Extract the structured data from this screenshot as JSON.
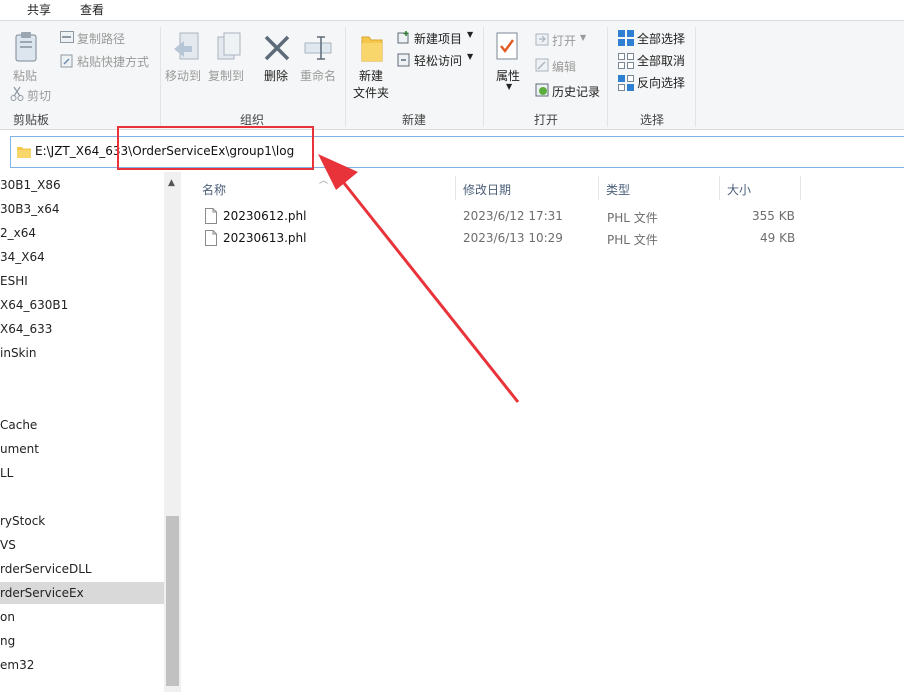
{
  "menu": {
    "tabs": [
      "共享",
      "查看"
    ]
  },
  "ribbon": {
    "clipboard": {
      "paste": "粘贴",
      "copy_path": "复制路径",
      "paste_shortcut": "粘贴快捷方式",
      "cut": "剪切",
      "label": "剪贴板"
    },
    "organize": {
      "move_to": "移动到",
      "copy_to": "复制到",
      "delete": "删除",
      "rename": "重命名",
      "label": "组织"
    },
    "new": {
      "new_folder_line1": "新建",
      "new_folder_line2": "文件夹",
      "new_item": "新建项目",
      "easy_access": "轻松访问",
      "label": "新建"
    },
    "open": {
      "properties": "属性",
      "open": "打开",
      "edit": "编辑",
      "history": "历史记录",
      "label": "打开"
    },
    "select": {
      "select_all": "全部选择",
      "select_none": "全部取消",
      "invert": "反向选择",
      "label": "选择"
    }
  },
  "address": {
    "path": "E:\\JZT_X64_633\\OrderServiceEx\\group1\\log"
  },
  "nav": {
    "items": [
      "30B1_X86",
      "30B3_x64",
      "2_x64",
      "34_X64",
      "ESHI",
      "X64_630B1",
      "X64_633",
      "inSkin",
      "",
      "",
      "Cache",
      "ument",
      "LL",
      "",
      "ryStock",
      "VS",
      "rderServiceDLL",
      "rderServiceEx",
      "on",
      "ng",
      "em32"
    ],
    "selected_index": 17
  },
  "columns": {
    "name": "名称",
    "modified": "修改日期",
    "type": "类型",
    "size": "大小"
  },
  "files": [
    {
      "name": "20230612.phl",
      "modified": "2023/6/12 17:31",
      "type": "PHL 文件",
      "size": "355 KB"
    },
    {
      "name": "20230613.phl",
      "modified": "2023/6/13 10:29",
      "type": "PHL 文件",
      "size": "49 KB"
    }
  ],
  "colors": {
    "accent": "#7fb2e5",
    "annotation": "#e8333a",
    "folder": "#f5c84c"
  }
}
